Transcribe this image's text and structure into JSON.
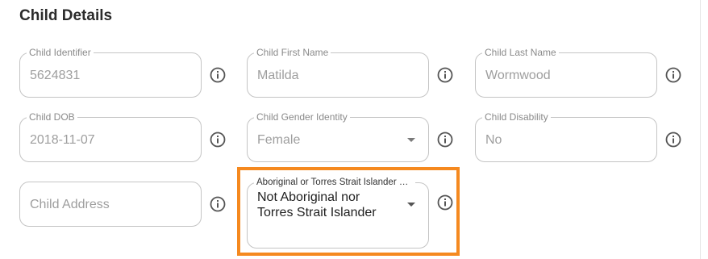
{
  "section": {
    "title": "Child Details"
  },
  "fields": {
    "child_identifier": {
      "label": "Child Identifier",
      "value": "5624831"
    },
    "child_first_name": {
      "label": "Child First Name",
      "value": "Matilda"
    },
    "child_last_name": {
      "label": "Child Last Name",
      "value": "Wormwood"
    },
    "child_dob": {
      "label": "Child DOB",
      "value": "2018-11-07"
    },
    "child_gender_identity": {
      "label": "Child Gender Identity",
      "value": "Female"
    },
    "child_disability": {
      "label": "Child Disability",
      "value": "No"
    },
    "child_address": {
      "placeholder": "Child Address"
    },
    "atsi_status": {
      "label": "Aboriginal or Torres Strait Islander S...",
      "value_line1": "Not Aboriginal nor",
      "value_line2": "Torres Strait Islander"
    }
  },
  "icons": {
    "info": "info-circle-icon",
    "dropdown": "triangle-down-icon"
  },
  "colors": {
    "highlight_border": "#f5891f",
    "field_border": "#c4c4c4",
    "muted_text": "#9e9e9e"
  }
}
